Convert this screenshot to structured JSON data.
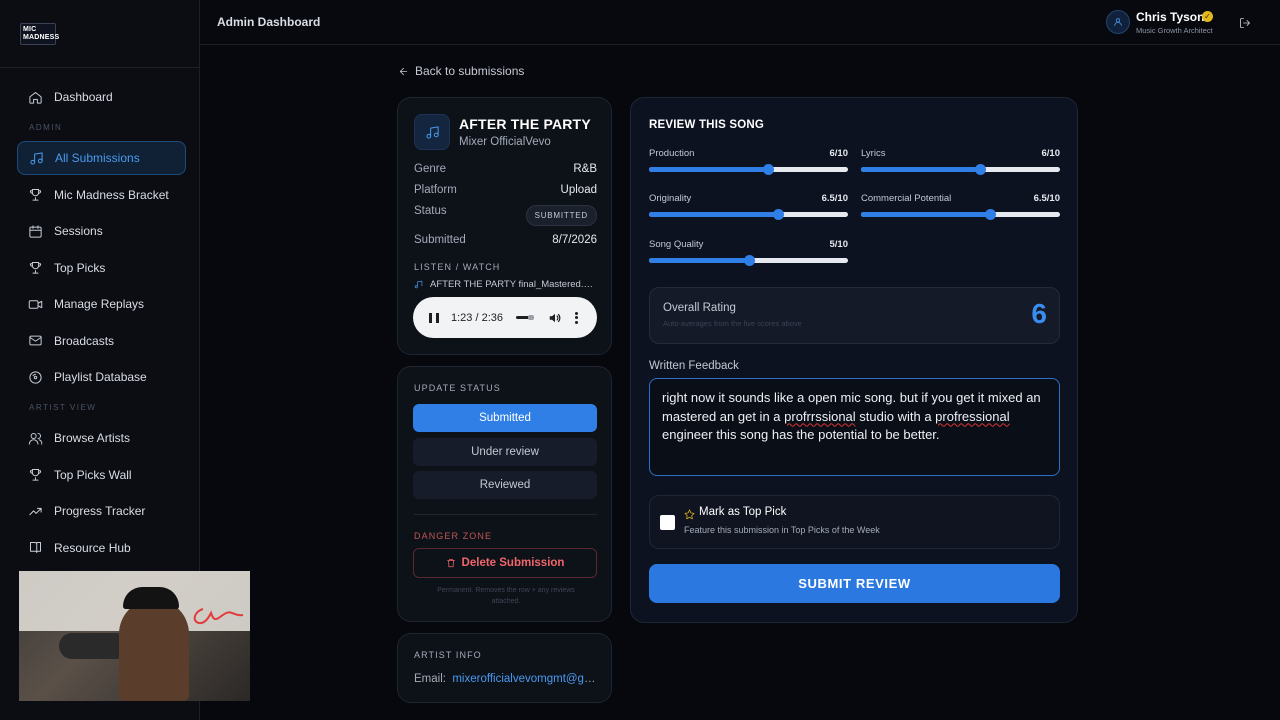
{
  "app": {
    "logo_line1": "MIC",
    "logo_line2": "MADNESS",
    "header_title": "Admin Dashboard"
  },
  "user": {
    "name": "Chris Tyson",
    "role": "Music Growth Architect",
    "icon": "user-icon",
    "badge_icon": "verified-badge-icon"
  },
  "sidebar": {
    "top_items": [
      {
        "label": "Dashboard",
        "icon": "home-icon"
      }
    ],
    "admin_section_label": "ADMIN",
    "admin_items": [
      {
        "label": "All Submissions",
        "icon": "music-note-icon",
        "active": true
      },
      {
        "label": "Mic Madness Bracket",
        "icon": "trophy-icon"
      },
      {
        "label": "Sessions",
        "icon": "calendar-icon"
      },
      {
        "label": "Top Picks",
        "icon": "trophy-icon"
      },
      {
        "label": "Manage Replays",
        "icon": "video-icon"
      },
      {
        "label": "Broadcasts",
        "icon": "mail-icon"
      },
      {
        "label": "Playlist Database",
        "icon": "disc-icon"
      }
    ],
    "artist_section_label": "ARTIST VIEW",
    "artist_items": [
      {
        "label": "Browse Artists",
        "icon": "users-icon"
      },
      {
        "label": "Top Picks Wall",
        "icon": "trophy-icon"
      },
      {
        "label": "Progress Tracker",
        "icon": "trending-up-icon"
      },
      {
        "label": "Resource Hub",
        "icon": "book-icon"
      }
    ]
  },
  "back_link": "Back to submissions",
  "song": {
    "title": "AFTER THE PARTY",
    "artist": "Mixer OfficialVevo",
    "genre_label": "Genre",
    "genre": "R&B",
    "platform_label": "Platform",
    "platform": "Upload",
    "status_label": "Status",
    "status": "SUBMITTED",
    "submitted_label": "Submitted",
    "submitted": "8/7/2026",
    "listen_label": "LISTEN / WATCH",
    "file_name": "AFTER THE PARTY final_Mastered.wav",
    "player_time": "1:23 / 2:36",
    "player_progress": 0.53
  },
  "update_status": {
    "label": "UPDATE STATUS",
    "options": [
      "Submitted",
      "Under review",
      "Reviewed"
    ],
    "selected": "Submitted",
    "danger_label": "DANGER ZONE",
    "delete_label": "Delete Submission",
    "delete_note": "Permanent. Removes the row + any reviews attached."
  },
  "artist_info": {
    "label": "ARTIST INFO",
    "email_label": "Email:",
    "email": "mixerofficialvevomgmt@gmail.com"
  },
  "review": {
    "title": "REVIEW THIS SONG",
    "scores": [
      {
        "label": "Production",
        "value": 6,
        "max": 10,
        "display": "6/10"
      },
      {
        "label": "Lyrics",
        "value": 6,
        "max": 10,
        "display": "6/10"
      },
      {
        "label": "Originality",
        "value": 6.5,
        "max": 10,
        "display": "6.5/10"
      },
      {
        "label": "Commercial Potential",
        "value": 6.5,
        "max": 10,
        "display": "6.5/10"
      },
      {
        "label": "Song Quality",
        "value": 5,
        "max": 10,
        "display": "5/10"
      }
    ],
    "overall_label": "Overall Rating",
    "overall_hint": "Auto-averages from the five scores above",
    "overall_value": "6",
    "feedback_label": "Written Feedback",
    "feedback_parts": [
      "right now it sounds like a open mic song. but if you get it mixed an mastered an get in a ",
      "profrrssional",
      " studio with a ",
      "profressional",
      " engineer this song has the potential to be better."
    ],
    "top_pick_label": "Mark as Top Pick",
    "top_pick_desc": "Feature this submission in Top Picks of the Week",
    "top_pick_checked": false,
    "submit_label": "SUBMIT REVIEW"
  }
}
